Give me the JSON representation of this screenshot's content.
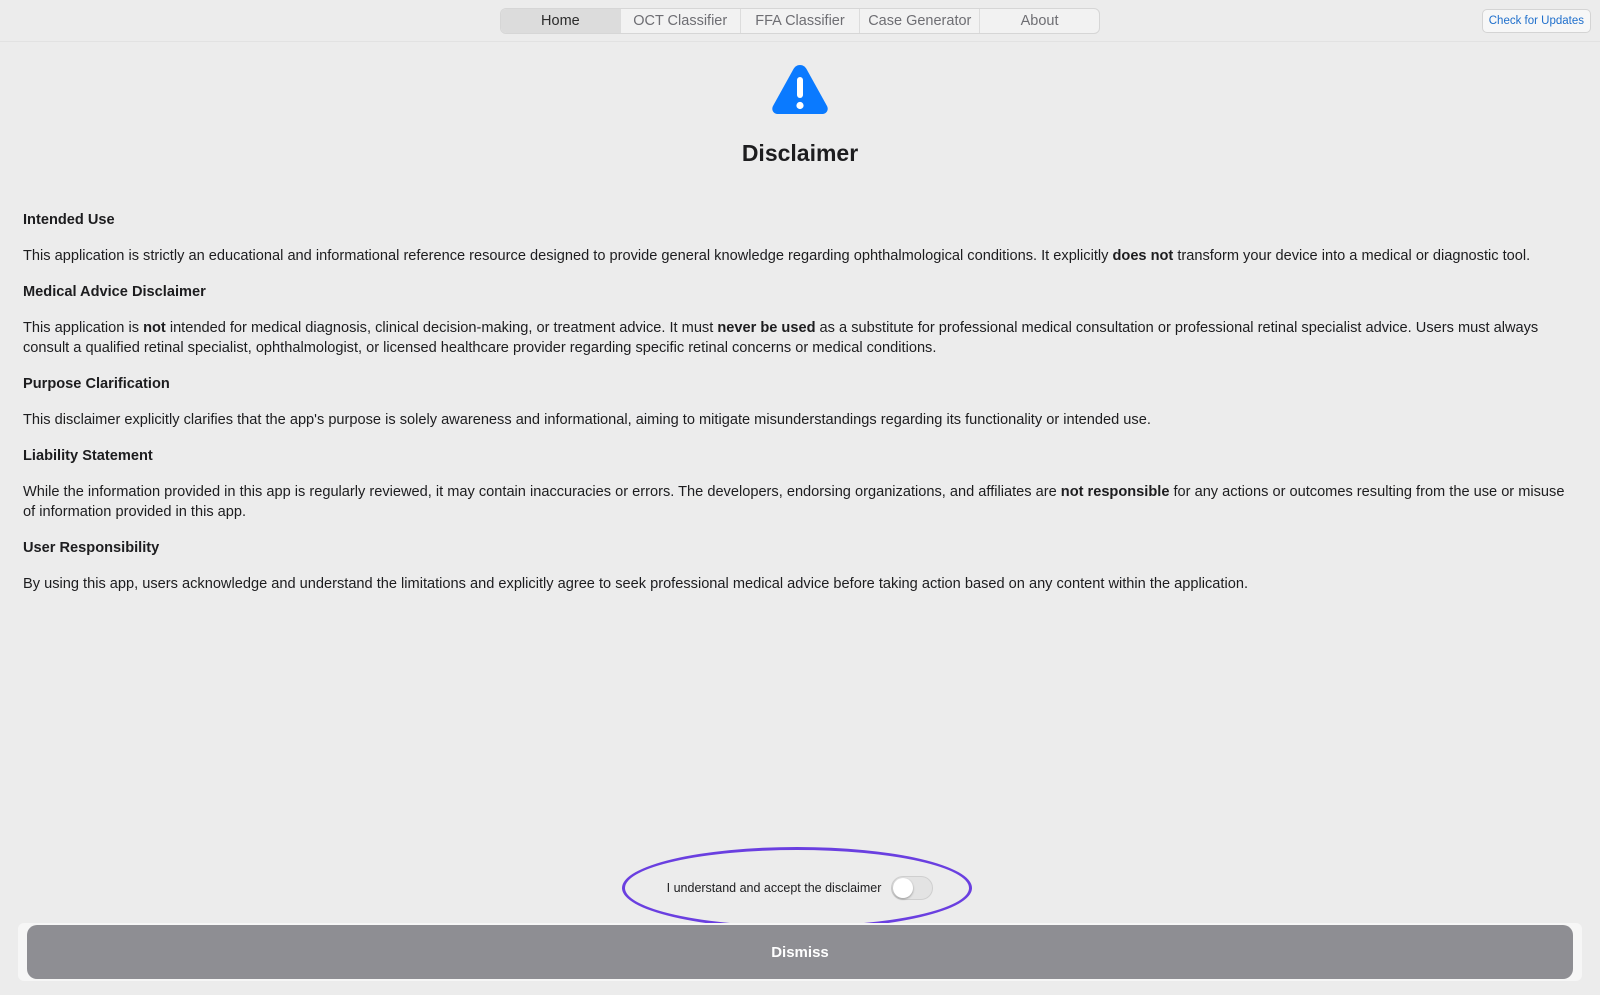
{
  "nav": {
    "tabs": [
      {
        "label": "Home",
        "active": true
      },
      {
        "label": "OCT Classifier",
        "active": false
      },
      {
        "label": "FFA Classifier",
        "active": false
      },
      {
        "label": "Case Generator",
        "active": false
      },
      {
        "label": "About",
        "active": false
      }
    ],
    "check_updates_label": "Check for Updates"
  },
  "header": {
    "icon": "warning-triangle-icon",
    "icon_color": "#0a7aff",
    "title": "Disclaimer"
  },
  "sections": [
    {
      "heading": "Intended Use",
      "body": [
        {
          "text": "This application is strictly an educational and informational reference resource designed to provide general knowledge regarding ophthalmological conditions. It explicitly "
        },
        {
          "text": "does not",
          "bold": true
        },
        {
          "text": " transform your device into a medical or diagnostic tool."
        }
      ]
    },
    {
      "heading": "Medical Advice Disclaimer",
      "body": [
        {
          "text": "This application is "
        },
        {
          "text": "not",
          "bold": true
        },
        {
          "text": " intended for medical diagnosis, clinical decision-making, or treatment advice. It must "
        },
        {
          "text": "never be used",
          "bold": true
        },
        {
          "text": " as a substitute for professional medical consultation or professional retinal specialist advice. Users must always consult a qualified retinal specialist, ophthalmologist, or licensed healthcare provider regarding specific retinal concerns or medical conditions."
        }
      ]
    },
    {
      "heading": "Purpose Clarification",
      "body": [
        {
          "text": "This disclaimer explicitly clarifies that the app's purpose is solely awareness and informational, aiming to mitigate misunderstandings regarding its functionality or intended use."
        }
      ]
    },
    {
      "heading": "Liability Statement",
      "body": [
        {
          "text": "While the information provided in this app is regularly reviewed, it may contain inaccuracies or errors. The developers, endorsing organizations, and affiliates are "
        },
        {
          "text": "not responsible",
          "bold": true
        },
        {
          "text": " for any actions or outcomes resulting from the use or misuse of information provided in this app."
        }
      ]
    },
    {
      "heading": "User Responsibility",
      "body": [
        {
          "text": "By using this app, users acknowledge and understand the limitations and explicitly agree to seek professional medical advice before taking action based on any content within the application."
        }
      ]
    }
  ],
  "acceptance": {
    "label": "I understand and accept the disclaimer",
    "toggle_on": false
  },
  "footer": {
    "dismiss_label": "Dismiss",
    "dismiss_color": "#8e8e93"
  },
  "annotation_color": "#6a3fe0"
}
